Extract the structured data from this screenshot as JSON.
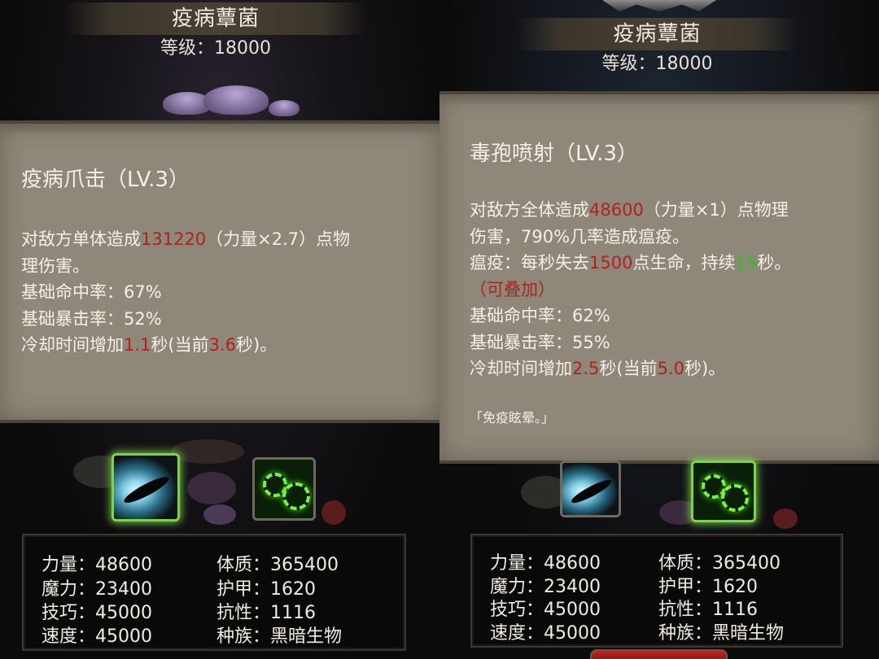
{
  "colors": {
    "card_bg": "#8f8779",
    "highlight_red": "#b0221d",
    "highlight_green": "#2ec12e",
    "selected_border": "#7fd34a"
  },
  "left": {
    "monster_name": "疫病蕈菌",
    "level_line": "等级：18000",
    "skill": {
      "name": "疫病爪击（LV.3）",
      "desc_line1_pre": "对敌方单体造成",
      "desc_damage": "131220",
      "desc_line1_post": "（力量×2.7）点物",
      "desc_line2": "理伤害。",
      "hit_rate": "基础命中率：67%",
      "crit_rate": "基础暴击率：52%",
      "cd_pre": "冷却时间增加",
      "cd_add": "1.1",
      "cd_mid": "秒(当前",
      "cd_current": "3.6",
      "cd_post": "秒)。"
    },
    "icons": [
      {
        "name": "slash-skill-icon",
        "selected": true
      },
      {
        "name": "spore-skill-icon",
        "selected": false
      }
    ],
    "stats": {
      "strength": "力量：48600",
      "magic": "魔力：23400",
      "skill": "技巧：45000",
      "speed": "速度：45000",
      "constitution": "体质：365400",
      "armor": "护甲：1620",
      "resistance": "抗性：1116",
      "race": "种族：黑暗生物"
    }
  },
  "right": {
    "monster_name": "疫病蕈菌",
    "level_line": "等级：18000",
    "skill": {
      "name": "毒孢喷射（LV.3）",
      "desc_line1_pre": "对敌方全体造成",
      "desc_damage": "48600",
      "desc_line1_post": "（力量×1）点物理",
      "desc_line2": "伤害，790%几率造成瘟疫。",
      "plague_pre": "瘟疫：每秒失去",
      "plague_hp": "1500",
      "plague_mid": "点生命，持续",
      "plague_secs": "15",
      "plague_post": "秒。",
      "stackable": "（可叠加）",
      "hit_rate": "基础命中率：62%",
      "crit_rate": "基础暴击率：55%",
      "cd_pre": "冷却时间增加",
      "cd_add": "2.5",
      "cd_mid": "秒(当前",
      "cd_current": "5.0",
      "cd_post": "秒)。",
      "quote": "「免疫眩晕。」"
    },
    "icons": [
      {
        "name": "slash-skill-icon",
        "selected": false
      },
      {
        "name": "spore-skill-icon",
        "selected": true
      }
    ],
    "stats": {
      "strength": "力量：48600",
      "magic": "魔力：23400",
      "skill": "技巧：45000",
      "speed": "速度：45000",
      "constitution": "体质：365400",
      "armor": "护甲：1620",
      "resistance": "抗性：1116",
      "race": "种族：黑暗生物"
    }
  }
}
